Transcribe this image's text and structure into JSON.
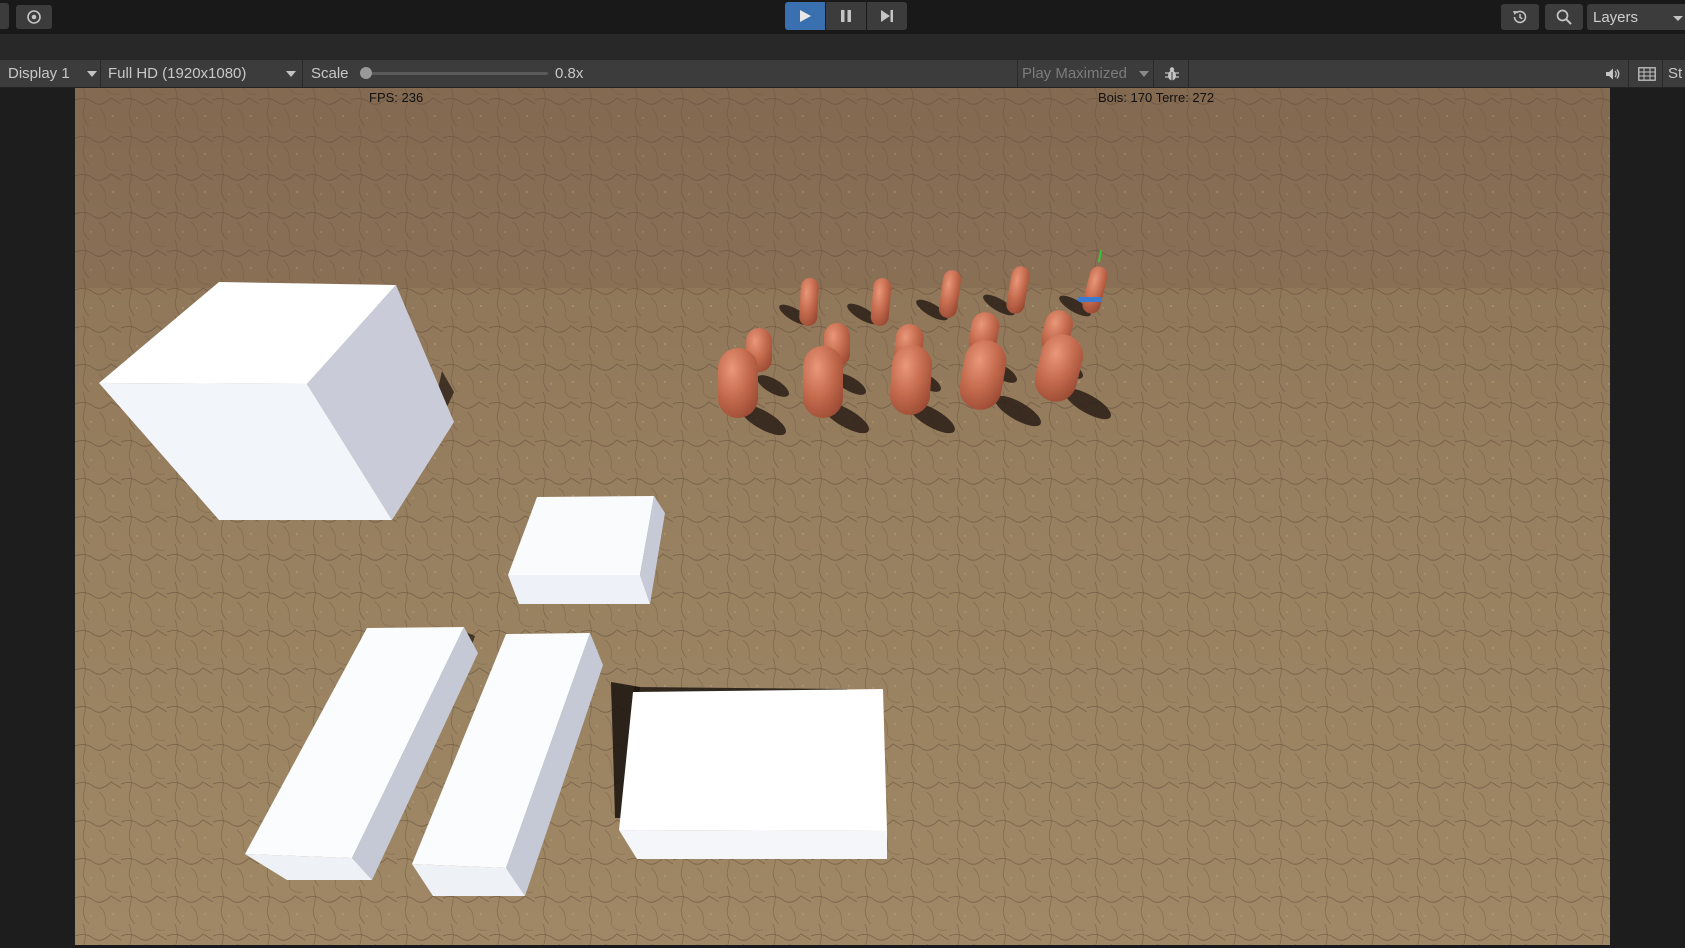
{
  "toolbar": {
    "play_icon": "play-icon",
    "pause_icon": "pause-icon",
    "step_icon": "step-icon",
    "layers_label": "Layers",
    "accent": "#3a70b0"
  },
  "game_toolbar": {
    "display_label": "Display 1",
    "resolution_label": "Full HD (1920x1080)",
    "scale_label": "Scale",
    "scale_value": "0.8x",
    "scale_fraction": 0.0,
    "play_maximized_label": "Play Maximized",
    "stats_label": "St"
  },
  "hud": {
    "fps_text": "FPS: 236",
    "resources_text": "Bois: 170 Terre: 272"
  },
  "colors": {
    "ground": "#8c7459",
    "capsule": "#c06a4e",
    "block": "#ffffff"
  }
}
